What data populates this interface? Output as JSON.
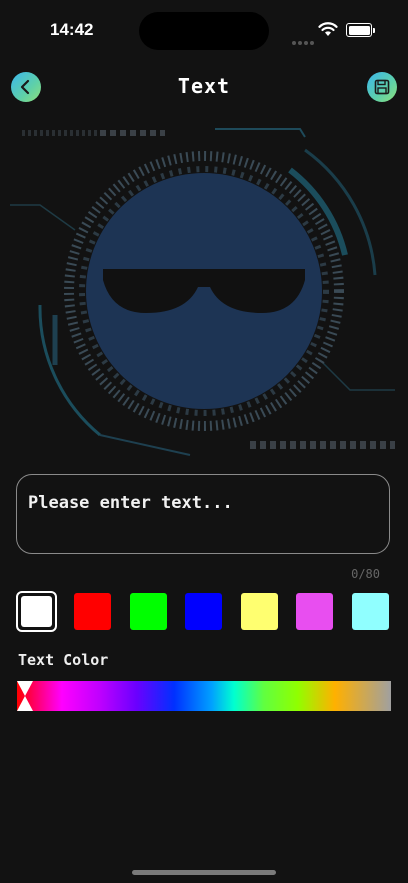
{
  "status_bar": {
    "time": "14:42"
  },
  "header": {
    "title": "Text",
    "back_icon": "chevron-left-icon",
    "save_icon": "floppy-disk-icon"
  },
  "preview": {
    "face_color": "#1d3454",
    "glasses_color": "#111111",
    "ring_color": "#3a4a55"
  },
  "text_input": {
    "value": "",
    "placeholder": "Please enter text..."
  },
  "counter": "0/80",
  "swatches": [
    {
      "name": "white",
      "color": "#ffffff",
      "selected": true
    },
    {
      "name": "red",
      "color": "#ff0000",
      "selected": false
    },
    {
      "name": "green",
      "color": "#00ff00",
      "selected": false
    },
    {
      "name": "blue",
      "color": "#0000ff",
      "selected": false
    },
    {
      "name": "yellow",
      "color": "#ffff70",
      "selected": false
    },
    {
      "name": "magenta",
      "color": "#e84ef0",
      "selected": false
    },
    {
      "name": "cyan",
      "color": "#90ffff",
      "selected": false
    }
  ],
  "color_section": {
    "label": "Text Color",
    "slider_value": 0
  }
}
